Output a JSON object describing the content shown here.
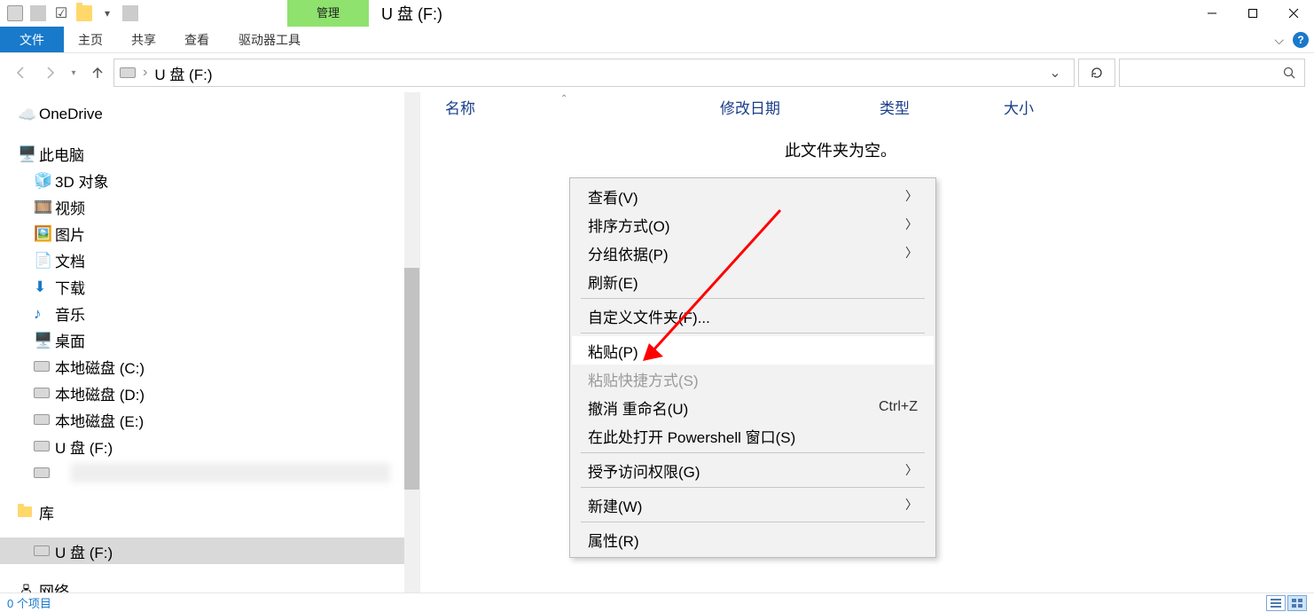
{
  "title_bar": {
    "contextual_tab": "管理",
    "window_title": "U 盘 (F:)"
  },
  "ribbon": {
    "file": "文件",
    "home": "主页",
    "share": "共享",
    "view": "查看",
    "drive_tools": "驱动器工具"
  },
  "address": {
    "path_sep": "›",
    "path_text": "U 盘 (F:)"
  },
  "nav_pane": {
    "onedrive": "OneDrive",
    "this_pc": "此电脑",
    "objects3d": "3D 对象",
    "videos": "视频",
    "pictures": "图片",
    "documents": "文档",
    "downloads": "下载",
    "music": "音乐",
    "desktop": "桌面",
    "disk_c": "本地磁盘 (C:)",
    "disk_d": "本地磁盘 (D:)",
    "disk_e": "本地磁盘 (E:)",
    "usb_f": "U 盘 (F:)",
    "libraries": "库",
    "usb_f2": "U 盘 (F:)",
    "network": "网络"
  },
  "columns": {
    "name": "名称",
    "date": "修改日期",
    "type": "类型",
    "size": "大小"
  },
  "content": {
    "empty_message": "此文件夹为空。"
  },
  "context_menu": {
    "view": "查看(V)",
    "sort": "排序方式(O)",
    "group": "分组依据(P)",
    "refresh": "刷新(E)",
    "customize": "自定义文件夹(F)...",
    "paste": "粘贴(P)",
    "paste_shortcut": "粘贴快捷方式(S)",
    "undo": "撤消 重命名(U)",
    "undo_key": "Ctrl+Z",
    "powershell": "在此处打开 Powershell 窗口(S)",
    "access": "授予访问权限(G)",
    "new": "新建(W)",
    "properties": "属性(R)"
  },
  "status_bar": {
    "items": "0 个项目"
  }
}
